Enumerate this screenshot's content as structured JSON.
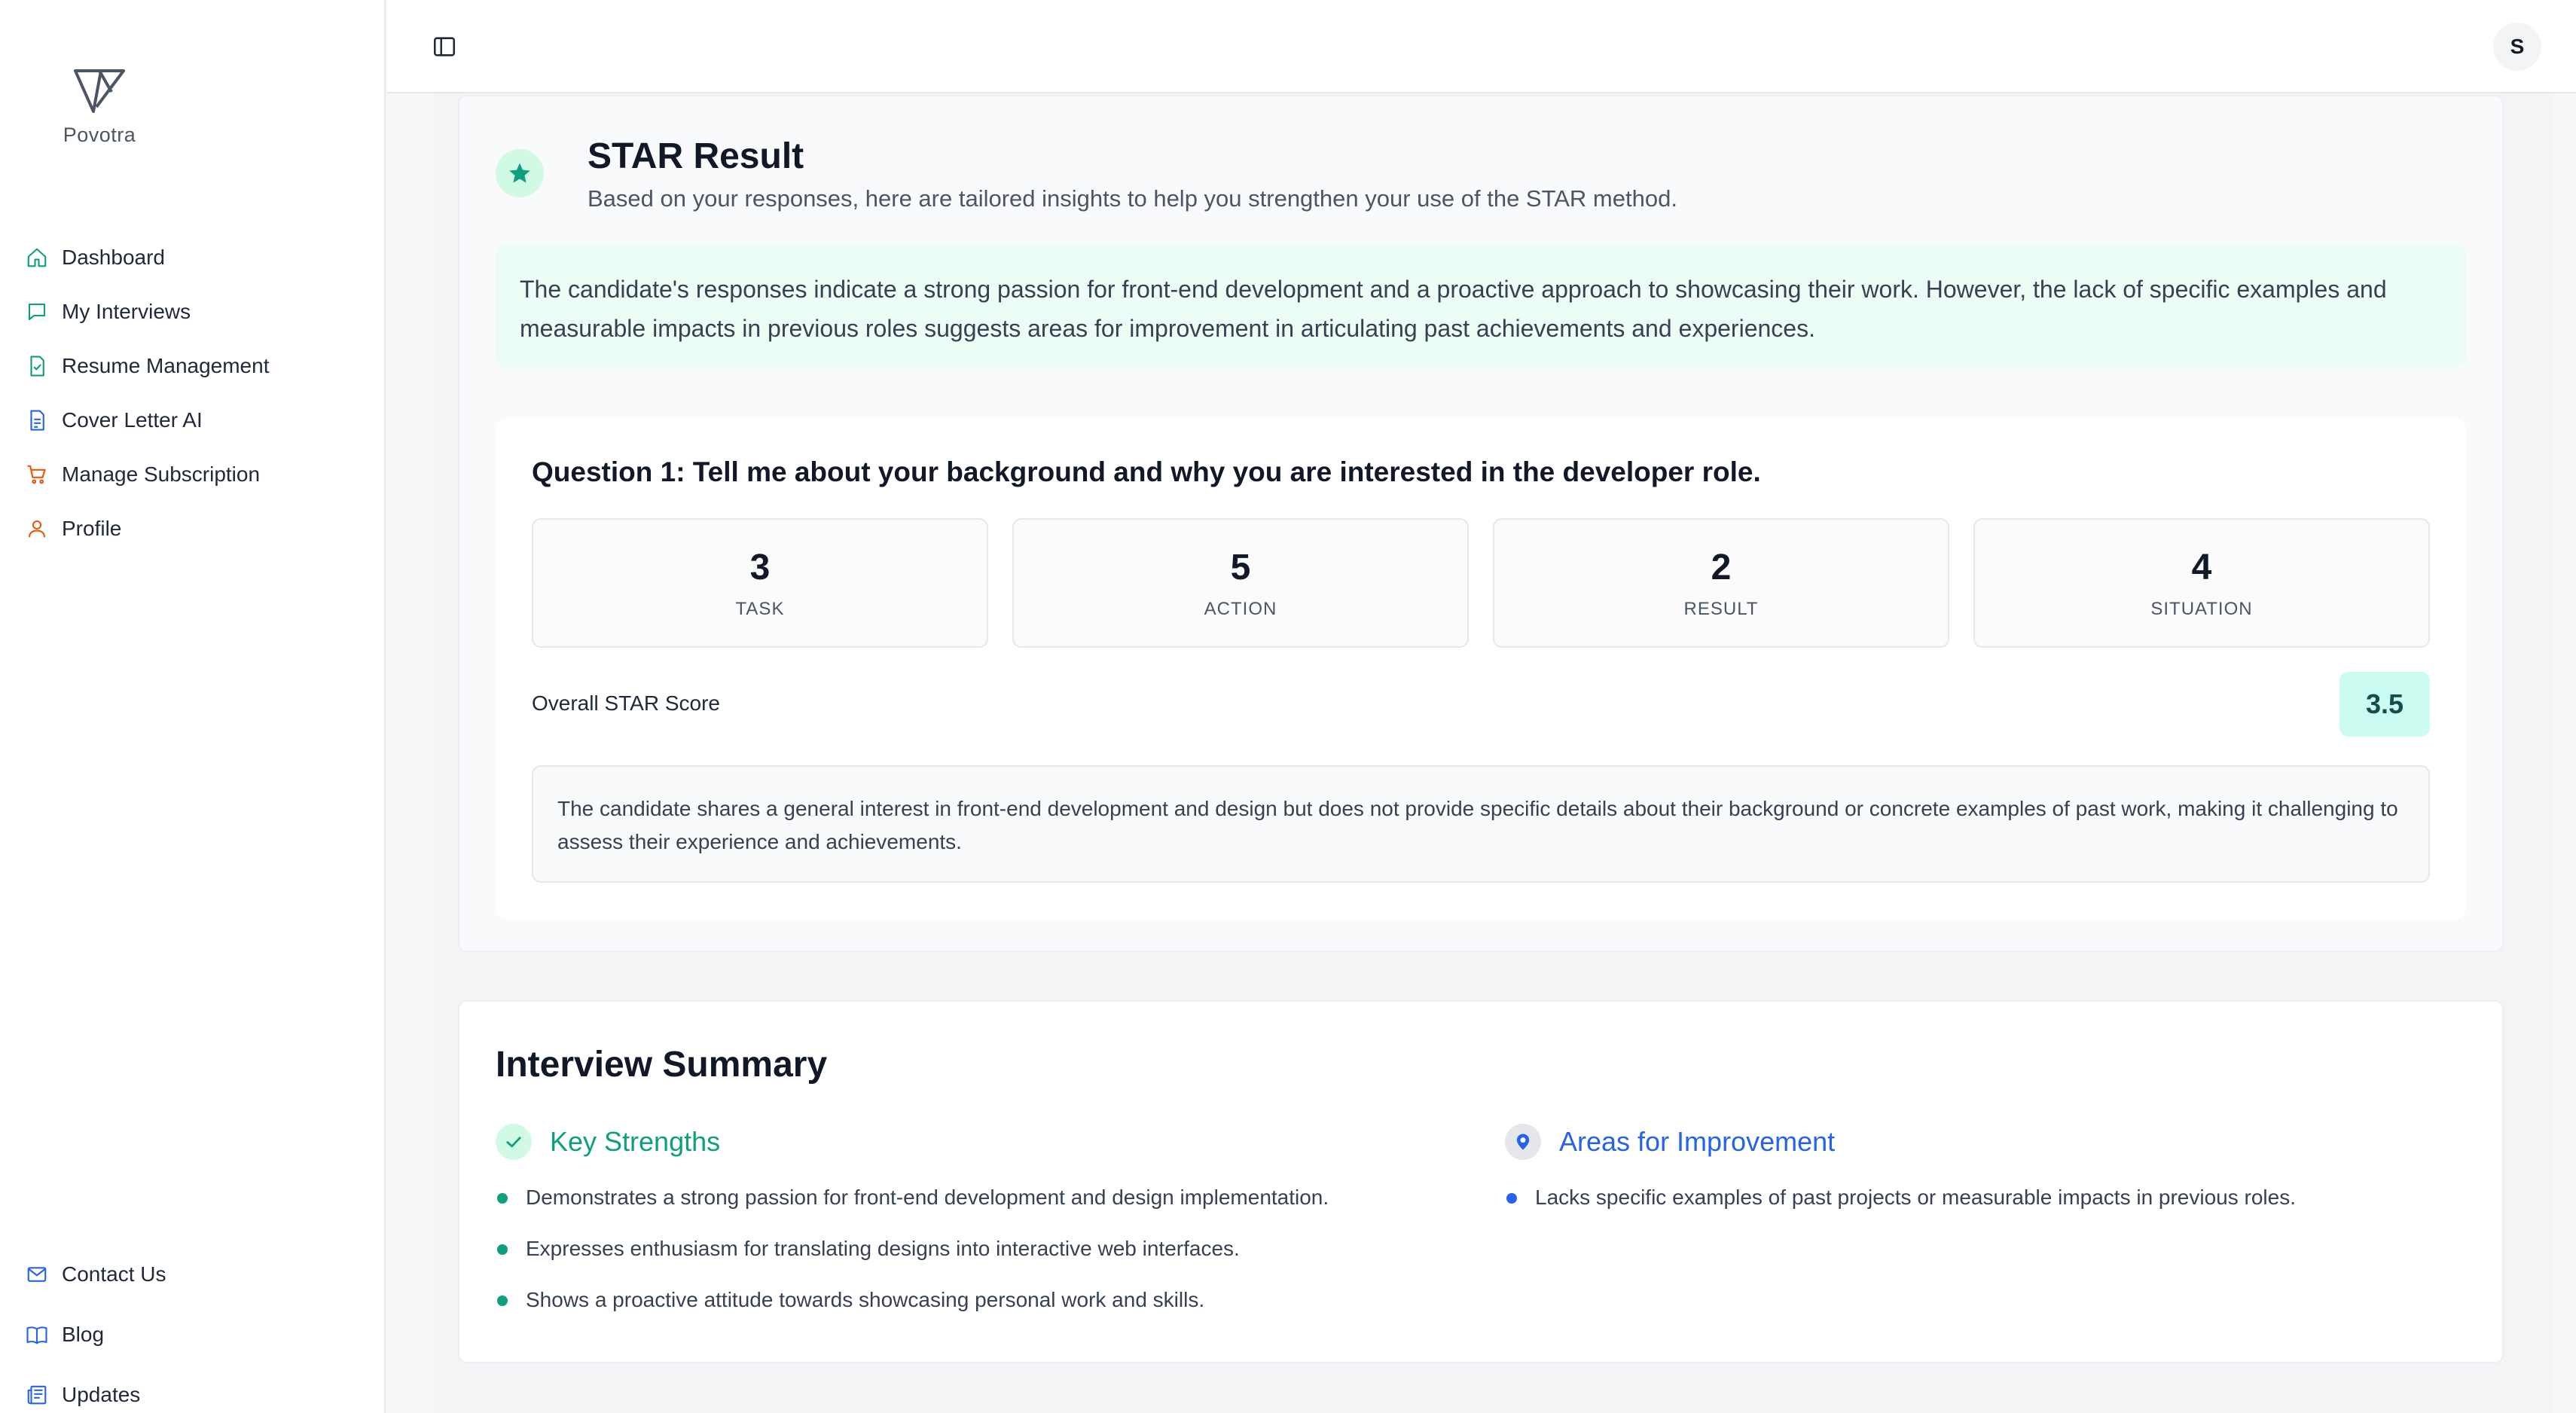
{
  "sidebar": {
    "logo_text": "Povotra",
    "nav": [
      {
        "label": "Dashboard",
        "icon": "home-icon"
      },
      {
        "label": "My Interviews",
        "icon": "chat-icon"
      },
      {
        "label": "Resume Management",
        "icon": "document-check-icon"
      },
      {
        "label": "Cover Letter AI",
        "icon": "document-text-icon"
      },
      {
        "label": "Manage Subscription",
        "icon": "cart-icon"
      },
      {
        "label": "Profile",
        "icon": "user-icon"
      }
    ],
    "bottom_nav": [
      {
        "label": "Contact Us",
        "icon": "mail-icon"
      },
      {
        "label": "Blog",
        "icon": "book-icon"
      },
      {
        "label": "Updates",
        "icon": "newspaper-icon"
      }
    ]
  },
  "header": {
    "avatar_initial": "S"
  },
  "star_result": {
    "title": "STAR Result",
    "subtitle": "Based on your responses, here are tailored insights to help you strengthen your use of the STAR method.",
    "insight": "The candidate's responses indicate a strong passion for front-end development and a proactive approach to showcasing their work. However, the lack of specific examples and measurable impacts in previous roles suggests areas for improvement in articulating past achievements and experiences.",
    "question": {
      "title": "Question 1: Tell me about your background and why you are interested in the developer role.",
      "scores": [
        {
          "value": "3",
          "label": "TASK"
        },
        {
          "value": "5",
          "label": "ACTION"
        },
        {
          "value": "2",
          "label": "RESULT"
        },
        {
          "value": "4",
          "label": "SITUATION"
        }
      ],
      "overall_label": "Overall STAR Score",
      "overall_value": "3.5",
      "feedback": "The candidate shares a general interest in front-end development and design but does not provide specific details about their background or concrete examples of past work, making it challenging to assess their experience and achievements."
    }
  },
  "summary": {
    "title": "Interview Summary",
    "strengths": {
      "title": "Key Strengths",
      "items": [
        "Demonstrates a strong passion for front-end development and design implementation.",
        "Expresses enthusiasm for translating designs into interactive web interfaces.",
        "Shows a proactive attitude towards showcasing personal work and skills."
      ]
    },
    "improvements": {
      "title": "Areas for Improvement",
      "items": [
        "Lacks specific examples of past projects or measurable impacts in previous roles."
      ]
    }
  },
  "colors": {
    "accent_green": "#0e9f7e",
    "accent_blue": "#2563eb",
    "insight_bg": "#ecfdf5",
    "score_bg": "#ccfbf1"
  }
}
